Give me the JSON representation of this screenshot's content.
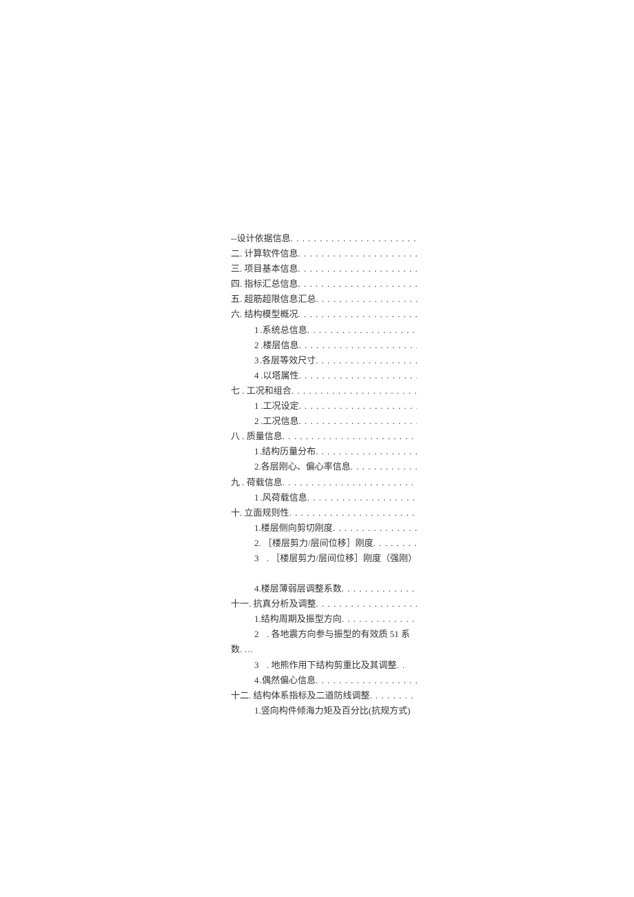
{
  "toc": {
    "s1": "--设计依据信息",
    "s2": "二. 计算软件信息",
    "s3": "三. 项目基本信息",
    "s4": "四. 指标汇总信息",
    "s5": "五. 超筋超限信息汇总",
    "s6": "六. 结构模型概况",
    "s6_1": ".系统总信息",
    "s6_2": ".楼层信息",
    "s6_3": ".各层等效尺寸",
    "s6_4": ".以塔属性",
    "s7": "七   . 工况和组合",
    "s7_1": ".工况设定",
    "s7_2": ".工况信息",
    "s8": "八   . 质量信息",
    "s8_1": ".结构历量分布",
    "s8_2": ".各层刚心、偏心率信息",
    "s9": "九   . 荷载信息",
    "s9_1": ".风荷载信息",
    "s10": "十. 立面规则性",
    "s10_1": ".楼层侧向剪切刚度",
    "s10_2": ". ［楼层剪力/层间位移］刚度",
    "s10_3": ". ［楼层剪力/层间位移］刚度（强刚）",
    "s10_4": ".楼层薄弱层调整系数",
    "s11": "十一. 抗真分析及调整",
    "s11_1": ".结构周期及振型方向",
    "s11_2": ". 各地震方向参与振型的有效质 51 系",
    "s11_2b": "数. …",
    "s11_3": ". 地熊作用下结构剪重比及其调整",
    "s11_4": ".偶然偏心信息",
    "s12": "十二. 结构体系指标及二道防线调整",
    "s12_1": "1.竖向构件倾海力矩及百分比(抗规方式)",
    "n1": "1",
    "n2": "2",
    "n3": "3",
    "n4": "4"
  }
}
